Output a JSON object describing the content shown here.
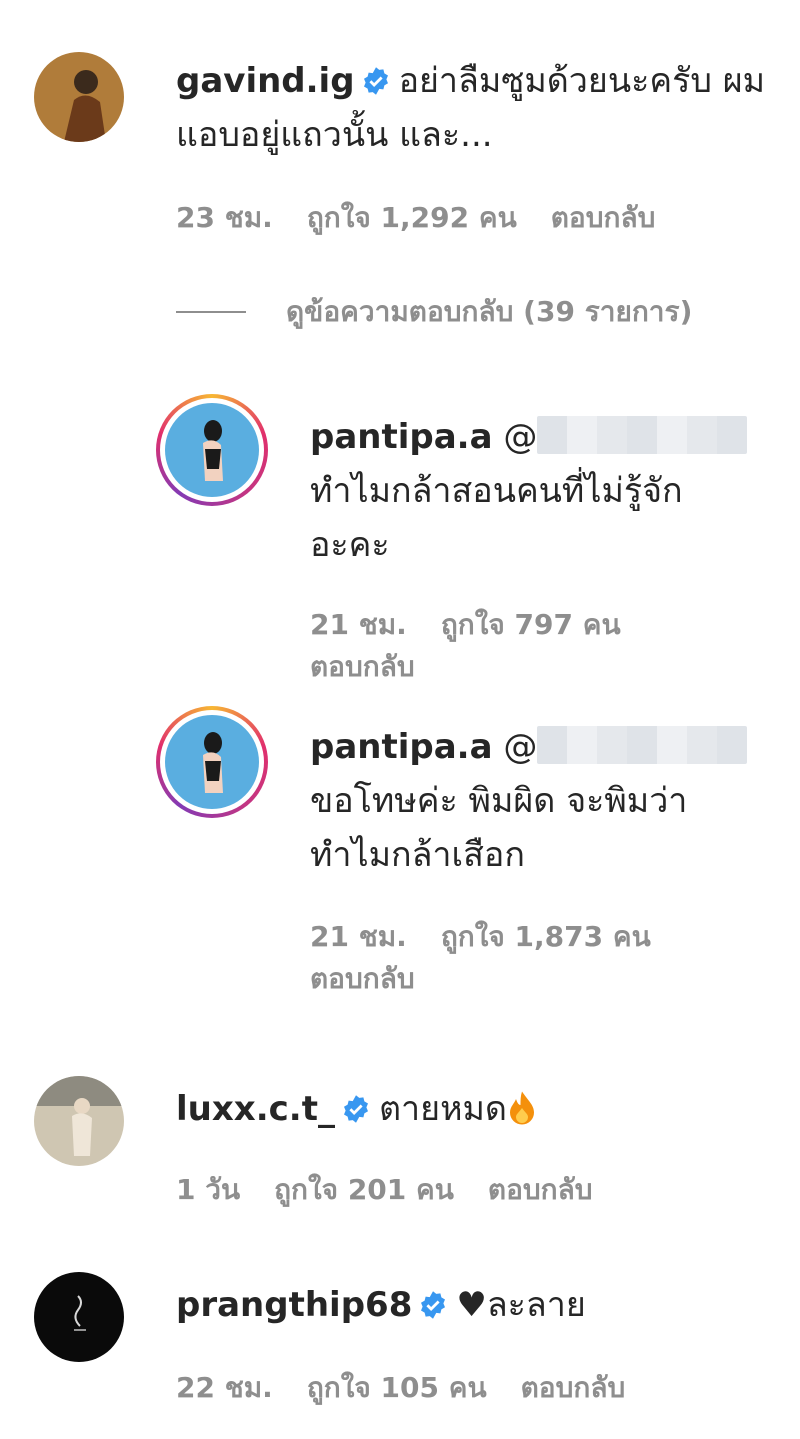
{
  "comments": [
    {
      "username": "gavind.ig",
      "text": "อย่าลืมซูมด้วยนะครับ ผมแอบอยู่แถวนั้น และ...",
      "time": "23 ชม.",
      "likes": "ถูกใจ 1,292 คน",
      "reply": "ตอบกลับ"
    },
    {
      "username": "luxx.c.t_",
      "text": "ตายหมด",
      "time": "1 วัน",
      "likes": "ถูกใจ 201 คน",
      "reply": "ตอบกลับ"
    },
    {
      "username": "prangthip68",
      "text": "♥ละลาย",
      "time": "22 ชม.",
      "likes": "ถูกใจ 105 คน",
      "reply": "ตอบกลับ"
    }
  ],
  "view_replies": "ดูข้อความตอบกลับ (39 รายการ)",
  "replies": [
    {
      "username": "pantipa.a",
      "mention": "@",
      "line1": "ทำไมกล้าสอนคนที่ไม่รู้จัก",
      "line2": "อะคะ",
      "time": "21 ชม.",
      "likes": "ถูกใจ 797 คน",
      "reply": "ตอบกลับ"
    },
    {
      "username": "pantipa.a",
      "mention": "@",
      "line1": "ขอโทษค่ะ พิมผิด จะพิมว่า",
      "line2": "ทำไมกล้าเสือก",
      "time": "21 ชม.",
      "likes": "ถูกใจ 1,873 คน",
      "reply": "ตอบกลับ"
    }
  ],
  "colors": {
    "text": "#262626",
    "meta": "#8e8e8e",
    "verified": "#3897f0",
    "avatar_story_ring": "#e1306c"
  },
  "icons": [
    "verified-badge-icon",
    "fire-emoji-icon"
  ]
}
